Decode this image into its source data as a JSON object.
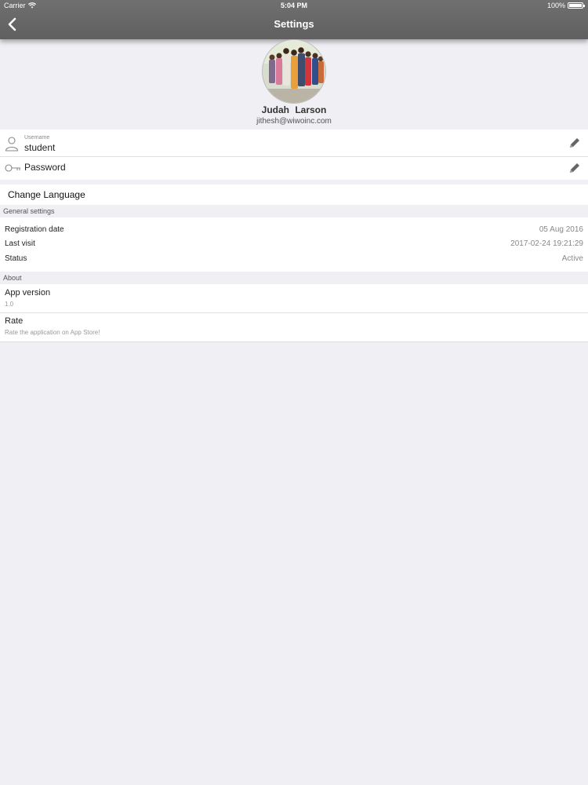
{
  "status_bar": {
    "carrier": "Carrier",
    "time": "5:04 PM",
    "battery": "100%",
    "battery_level": 1.0
  },
  "nav": {
    "title": "Settings"
  },
  "profile": {
    "first_name": "Judah",
    "last_name": "Larson",
    "email": "jithesh@wiwoinc.com"
  },
  "account": {
    "username_label": "Username",
    "username_value": "student",
    "password_label": "Password"
  },
  "language": {
    "label": "Change Language"
  },
  "general": {
    "header": "General settings",
    "rows": [
      {
        "label": "Registration date",
        "value": "05 Aug 2016"
      },
      {
        "label": "Last visit",
        "value": "2017-02-24 19:21:29"
      },
      {
        "label": "Status",
        "value": "Active"
      }
    ]
  },
  "about": {
    "header": "About",
    "version_label": "App version",
    "version_value": "1.0",
    "rate_label": "Rate",
    "rate_sub": "Rate the application on App Store!"
  }
}
